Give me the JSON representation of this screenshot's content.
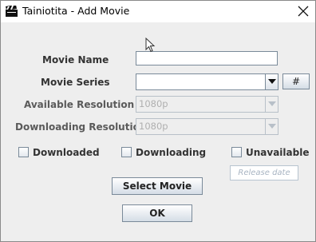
{
  "window": {
    "title": "Tainiotita - Add Movie",
    "icon": "film-clapper-icon",
    "close_icon": "close-icon"
  },
  "form": {
    "movie_name": {
      "label": "Movie Name",
      "value": ""
    },
    "movie_series": {
      "label": "Movie Series",
      "value": "",
      "number_button": "#"
    },
    "available_resolution": {
      "label": "Available Resolution",
      "value": "1080p"
    },
    "downloading_resolution": {
      "label": "Downloading Resolution",
      "value": "1080p"
    }
  },
  "checkboxes": [
    {
      "label": "Downloaded",
      "checked": false
    },
    {
      "label": "Downloading",
      "checked": false
    },
    {
      "label": "Unavailable",
      "checked": false
    }
  ],
  "release_date": {
    "placeholder": "Release date"
  },
  "buttons": {
    "select_movie": "Select Movie",
    "ok": "OK"
  }
}
